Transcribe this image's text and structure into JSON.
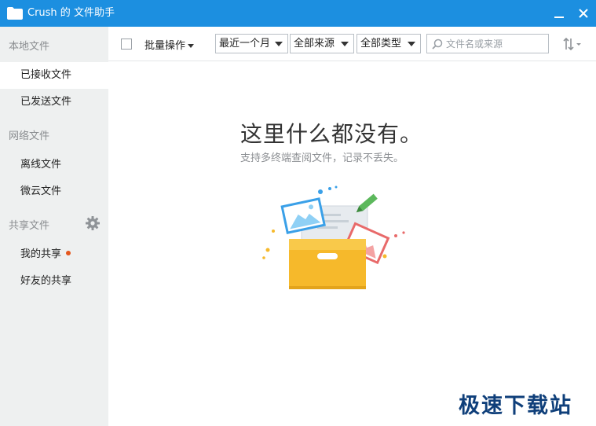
{
  "window": {
    "title": "Crush 的 文件助手"
  },
  "sidebar": {
    "groups": [
      {
        "label": "本地文件",
        "items": [
          {
            "label": "已接收文件"
          },
          {
            "label": "已发送文件"
          }
        ]
      },
      {
        "label": "网络文件",
        "items": [
          {
            "label": "离线文件"
          },
          {
            "label": "微云文件"
          }
        ]
      },
      {
        "label": "共享文件",
        "items": [
          {
            "label": "我的共享",
            "has_dot": true
          },
          {
            "label": "好友的共享"
          }
        ]
      }
    ],
    "selected": "已接收文件"
  },
  "toolbar": {
    "batch_label": "批量操作",
    "filters": {
      "time": "最近一个月",
      "source": "全部来源",
      "type": "全部类型"
    },
    "search_placeholder": "文件名或来源"
  },
  "empty_state": {
    "title": "这里什么都没有。",
    "subtitle": "支持多终端查阅文件，记录不丢失。"
  },
  "watermark": "极速下载站",
  "colors": {
    "titlebar": "#1c8fe0",
    "sidebar_bg": "#eef0f0",
    "notification_dot": "#e4571e",
    "folder_yellow": "#f6b92b"
  }
}
